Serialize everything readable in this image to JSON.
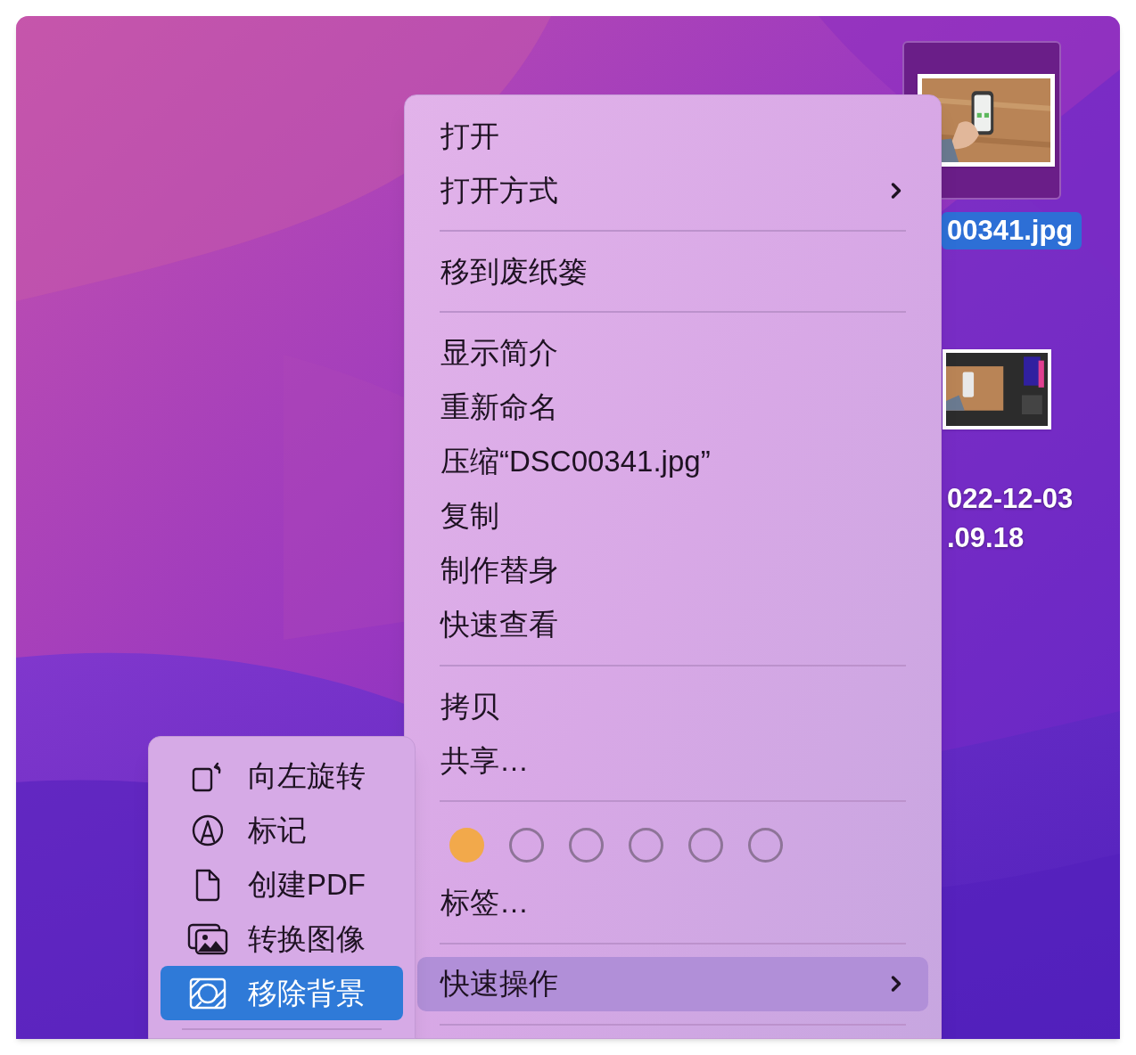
{
  "desktop": {
    "files": [
      {
        "label": "00341.jpg",
        "selected": true
      },
      {
        "kind": "screenshot",
        "label_lines": [
          "022-12-03",
          ".09.18"
        ],
        "selected": false
      }
    ]
  },
  "context_menu": {
    "items": [
      {
        "kind": "item",
        "label": "打开",
        "submenu": false,
        "highlighted": false
      },
      {
        "kind": "item",
        "label": "打开方式",
        "submenu": true,
        "highlighted": false
      },
      {
        "kind": "separator"
      },
      {
        "kind": "item",
        "label": "移到废纸篓",
        "submenu": false,
        "highlighted": false
      },
      {
        "kind": "separator"
      },
      {
        "kind": "item",
        "label": "显示简介",
        "submenu": false,
        "highlighted": false
      },
      {
        "kind": "item",
        "label": "重新命名",
        "submenu": false,
        "highlighted": false
      },
      {
        "kind": "item",
        "label": "压缩“DSC00341.jpg”",
        "submenu": false,
        "highlighted": false
      },
      {
        "kind": "item",
        "label": "复制",
        "submenu": false,
        "highlighted": false
      },
      {
        "kind": "item",
        "label": "制作替身",
        "submenu": false,
        "highlighted": false
      },
      {
        "kind": "item",
        "label": "快速查看",
        "submenu": false,
        "highlighted": false
      },
      {
        "kind": "separator"
      },
      {
        "kind": "item",
        "label": "拷贝",
        "submenu": false,
        "highlighted": false
      },
      {
        "kind": "item",
        "label": "共享…",
        "submenu": false,
        "highlighted": false
      },
      {
        "kind": "separator"
      },
      {
        "kind": "tags",
        "tags": [
          {
            "filled": true,
            "color": "#f2a94b"
          },
          {
            "filled": false
          },
          {
            "filled": false
          },
          {
            "filled": false
          },
          {
            "filled": false
          },
          {
            "filled": false
          }
        ]
      },
      {
        "kind": "item",
        "label": "标签…",
        "submenu": false,
        "highlighted": false
      },
      {
        "kind": "separator"
      },
      {
        "kind": "item",
        "label": "快速操作",
        "submenu": true,
        "highlighted": true
      },
      {
        "kind": "separator"
      }
    ]
  },
  "quick_actions_menu": {
    "items": [
      {
        "kind": "rotate",
        "label": "向左旋转",
        "selected": false
      },
      {
        "kind": "markup",
        "label": "标记",
        "selected": false
      },
      {
        "kind": "document",
        "label": "创建PDF",
        "selected": false
      },
      {
        "kind": "images",
        "label": "转换图像",
        "selected": false
      },
      {
        "kind": "remove-background",
        "label": "移除背景",
        "selected": true
      },
      {
        "kind": "separator"
      }
    ]
  }
}
